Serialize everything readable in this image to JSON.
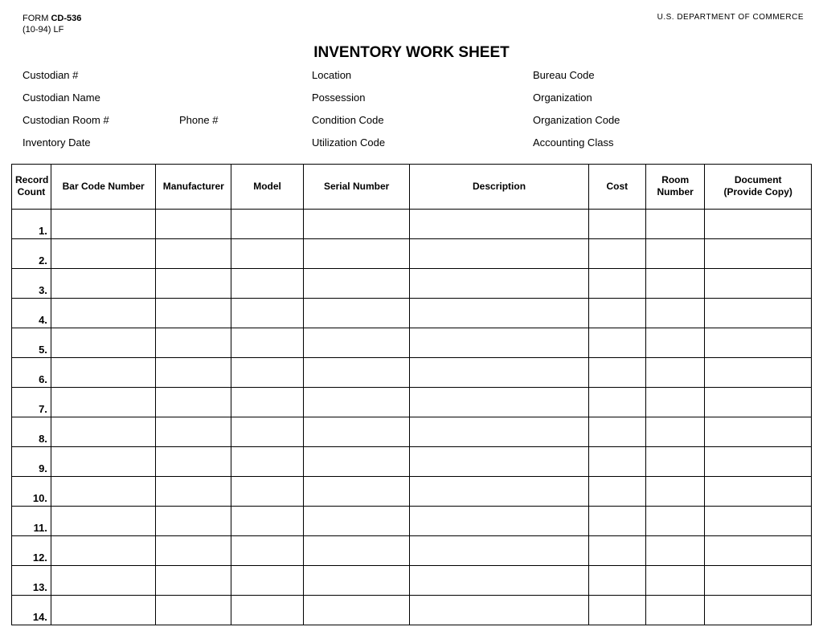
{
  "header": {
    "form_prefix": "FORM ",
    "form_number": "CD-536",
    "form_revision": "(10-94)  LF",
    "department": "U.S.  DEPARTMENT  OF  COMMERCE",
    "title": "INVENTORY WORK SHEET"
  },
  "fields": {
    "custodian_num": "Custodian #",
    "custodian_name": "Custodian Name",
    "custodian_room": "Custodian Room #",
    "phone": "Phone #",
    "inventory_date": "Inventory Date",
    "location": "Location",
    "possession": "Possession",
    "condition_code": "Condition Code",
    "utilization_code": "Utilization Code",
    "bureau_code": "Bureau Code",
    "organization": "Organization",
    "organization_code": "Organization Code",
    "accounting_class": "Accounting Class"
  },
  "columns": {
    "record_count": "Record\nCount",
    "bar_code": "Bar Code Number",
    "manufacturer": "Manufacturer",
    "model": "Model",
    "serial": "Serial Number",
    "description": "Description",
    "cost": "Cost",
    "room": "Room\nNumber",
    "document": "Document\n(Provide Copy)"
  },
  "rows": [
    {
      "n": "1."
    },
    {
      "n": "2."
    },
    {
      "n": "3."
    },
    {
      "n": "4."
    },
    {
      "n": "5."
    },
    {
      "n": "6."
    },
    {
      "n": "7."
    },
    {
      "n": "8."
    },
    {
      "n": "9."
    },
    {
      "n": "10."
    },
    {
      "n": "11."
    },
    {
      "n": "12."
    },
    {
      "n": "13."
    },
    {
      "n": "14."
    }
  ]
}
